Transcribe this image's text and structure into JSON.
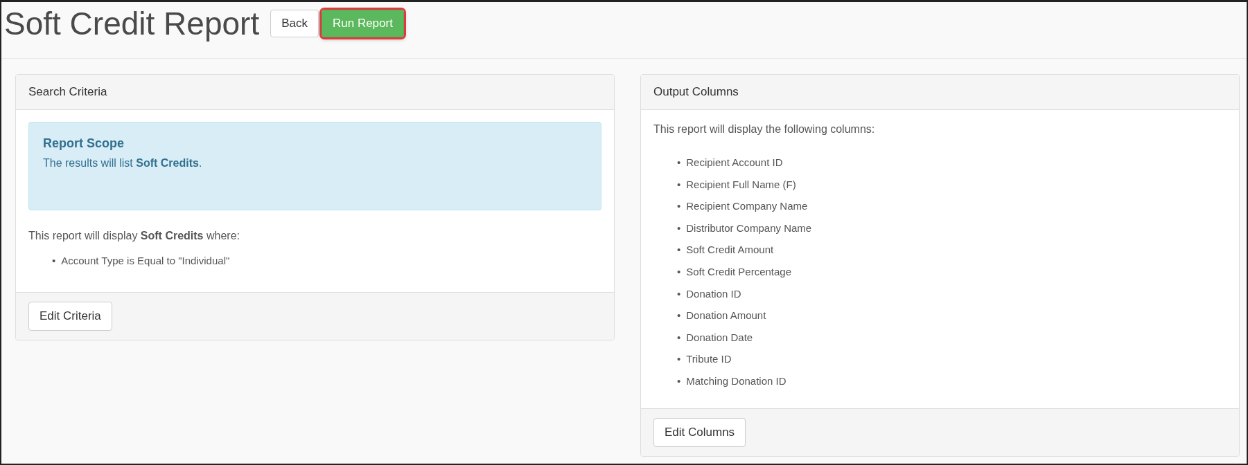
{
  "page": {
    "title": "Soft Credit Report",
    "buttons": [
      {
        "label": "Back",
        "kind": "default",
        "highlighted": false
      },
      {
        "label": "Run Report",
        "kind": "success",
        "highlighted": true
      }
    ]
  },
  "search_criteria": {
    "title": "Search Criteria",
    "alert": {
      "heading": "Report Scope",
      "text": "The results will list **Soft Credits**."
    },
    "intro": "This report will display **Soft Credits** where:",
    "conditions": [
      {
        "bullet": "•",
        "text": "Account Type is Equal to \"Individual\""
      }
    ],
    "button": "Edit Criteria"
  },
  "output_columns": {
    "title": "Output Columns",
    "intro": "This report will display the following columns:",
    "columns": [
      {
        "bullet": "•",
        "text": "Recipient Account ID"
      },
      {
        "bullet": "•",
        "text": "Recipient Full Name (F)"
      },
      {
        "bullet": "•",
        "text": "Recipient Company Name"
      },
      {
        "bullet": "•",
        "text": "Distributor Company Name"
      },
      {
        "bullet": "•",
        "text": "Soft Credit Amount"
      },
      {
        "bullet": "•",
        "text": "Soft Credit Percentage"
      },
      {
        "bullet": "•",
        "text": "Donation ID"
      },
      {
        "bullet": "•",
        "text": "Donation Amount"
      },
      {
        "bullet": "•",
        "text": "Donation Date"
      },
      {
        "bullet": "•",
        "text": "Tribute ID"
      },
      {
        "bullet": "•",
        "text": "Matching Donation ID"
      }
    ],
    "button": "Edit Columns"
  }
}
